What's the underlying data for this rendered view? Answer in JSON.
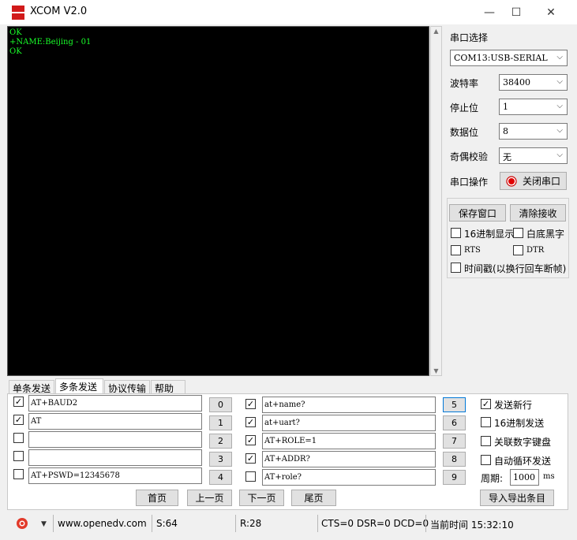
{
  "window": {
    "title": "XCOM V2.0",
    "logo_text": "ATK XCOM",
    "min_glyph": "—",
    "max_glyph": "☐",
    "close_glyph": "✕"
  },
  "terminal": {
    "lines": [
      "OK",
      "+NAME:Beijing - 01",
      "OK"
    ],
    "text_color": "#19ff2a",
    "bg_color": "#000000"
  },
  "settings": {
    "port_label": "串口选择",
    "port_value": "COM13:USB-SERIAL",
    "baud_label": "波特率",
    "baud_value": "38400",
    "stop_label": "停止位",
    "stop_value": "1",
    "data_label": "数据位",
    "data_value": "8",
    "parity_label": "奇偶校验",
    "parity_value": "无",
    "op_label": "串口操作",
    "op_button": "关闭串口",
    "save_window": "保存窗口",
    "clear_receive": "清除接收",
    "hex_display": "16进制显示",
    "white_bg": "白底黑字",
    "rts": "RTS",
    "dtr": "DTR",
    "timestamp": "时间戳(以换行回车断帧)"
  },
  "tabs": [
    "单条发送",
    "多条发送",
    "协议传输",
    "帮助"
  ],
  "multi_send": {
    "left": [
      {
        "checked": true,
        "text": "AT+BAUD2",
        "num": "0"
      },
      {
        "checked": true,
        "text": "AT",
        "num": "1"
      },
      {
        "checked": false,
        "text": "",
        "num": "2"
      },
      {
        "checked": false,
        "text": "",
        "num": "3"
      },
      {
        "checked": false,
        "text": "AT+PSWD=12345678",
        "num": "4"
      }
    ],
    "right": [
      {
        "checked": true,
        "text": "at+name?",
        "num": "5"
      },
      {
        "checked": true,
        "text": "at+uart?",
        "num": "6"
      },
      {
        "checked": true,
        "text": "AT+ROLE=1",
        "num": "7"
      },
      {
        "checked": true,
        "text": "AT+ADDR?",
        "num": "8"
      },
      {
        "checked": false,
        "text": "AT+role?",
        "num": "9"
      }
    ],
    "send_newline": "发送新行",
    "hex_send": "16进制发送",
    "link_keypad": "关联数字键盘",
    "auto_loop": "自动循环发送",
    "period_label": "周期:",
    "period_value": "1000",
    "period_unit": "ms",
    "first_page": "首页",
    "prev_page": "上一页",
    "next_page": "下一页",
    "last_page": "尾页",
    "import_export": "导入导出条目"
  },
  "statusbar": {
    "url": "www.openedv.com",
    "sent": "S:64",
    "received": "R:28",
    "signals": "CTS=0 DSR=0 DCD=0",
    "time": "当前时间 15:32:10"
  },
  "colors": {
    "accent_blue": "#0078d7",
    "record_red": "#e00000"
  }
}
